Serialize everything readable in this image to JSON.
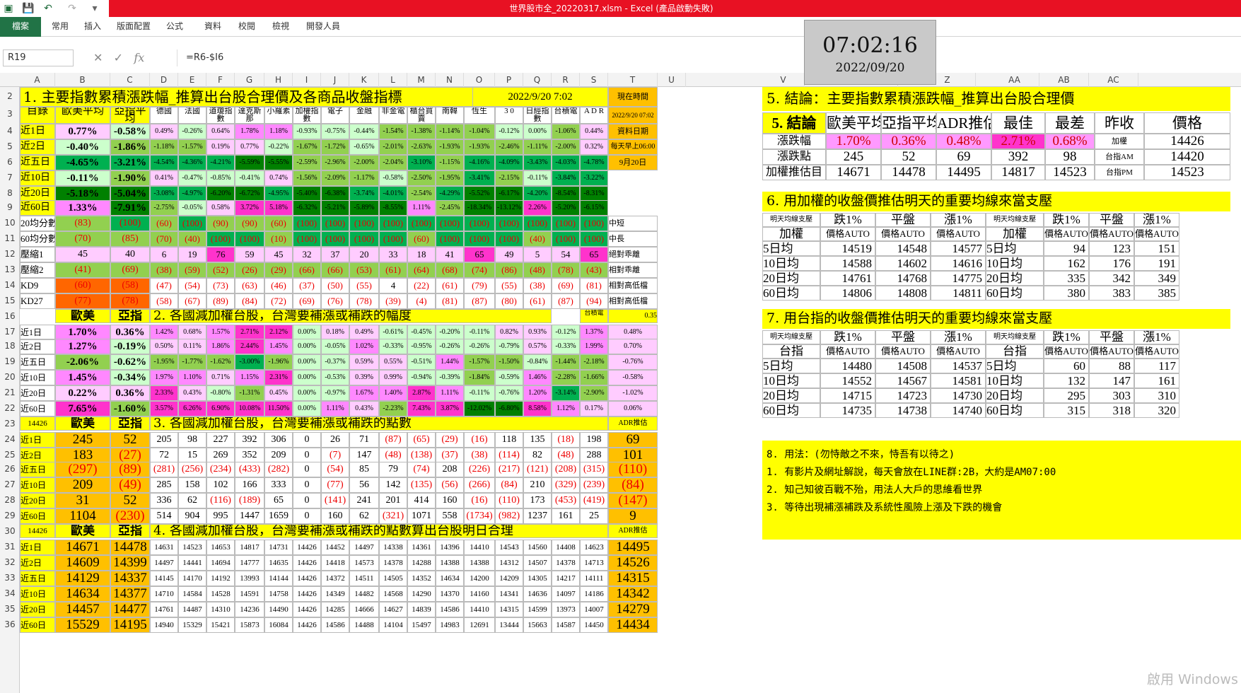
{
  "window": {
    "title": "世界股市全_20220317.xlsm - Excel (產品啟動失敗)"
  },
  "ribbon": {
    "tabs": [
      "檔案",
      "常用",
      "插入",
      "版面配置",
      "公式",
      "資料",
      "校閱",
      "檢視",
      "開發人員"
    ]
  },
  "formula_bar": {
    "name_box": "R19",
    "formula": "=R6-$I6"
  },
  "clock": {
    "time": "07:02:16",
    "date": "2022/09/20"
  },
  "columns": [
    "A",
    "B",
    "C",
    "D",
    "E",
    "F",
    "G",
    "H",
    "I",
    "J",
    "K",
    "L",
    "M",
    "N",
    "O",
    "P",
    "Q",
    "R",
    "S",
    "T",
    "U",
    "V",
    "Y",
    "Z",
    "AA",
    "AB",
    "AC"
  ],
  "rows": [
    "2",
    "3",
    "4",
    "5",
    "6",
    "7",
    "8",
    "9",
    "10",
    "11",
    "12",
    "13",
    "14",
    "15",
    "16",
    "17",
    "18",
    "19",
    "20",
    "21",
    "22",
    "23",
    "24",
    "25",
    "26",
    "27",
    "28",
    "29",
    "30",
    "31",
    "32",
    "33",
    "34",
    "35",
    "36"
  ],
  "section1": {
    "title": "1. 主要指數累積漲跌幅_推算出台股合理價及各商品收盤指標",
    "stamp": "2022/9/20  7:02",
    "now_label": "現在時間",
    "now_value": "2022/9/20 07:02",
    "date_label": "資料日期",
    "date_note": "每天早上06:00",
    "date_value": "9月20日"
  },
  "section2": {
    "title": "2. 各國減加權台股，台灣要補漲或補跌的幅度",
    "ratio": "0.35"
  },
  "section3": {
    "title": "3. 各國減加權台股，台灣要補漲或補跌的點數",
    "base": "14426",
    "adr": "ADR推估"
  },
  "section4": {
    "title": "4. 各國減加權台股，台灣要補漲或補跌的點數算出台股明日合理",
    "base": "14426",
    "adr": "ADR推估"
  },
  "header_row": [
    "目錄",
    "歐美平均",
    "亞指平均",
    "德國",
    "法國",
    "道瓊指數",
    "達克斯那",
    "小羅素",
    "加權指數",
    "電子",
    "金融",
    "非金電",
    "櫃台買賣",
    "南韓",
    "恆生",
    "3 0",
    "日經指數",
    "台積電",
    "A D R"
  ],
  "row_labels": [
    "近1日",
    "近2日",
    "近五日",
    "近10日",
    "近20日",
    "近60日"
  ],
  "s1_rows": [
    [
      "0.77%",
      "-0.58%",
      "0.49%",
      "-0.26%",
      "0.64%",
      "1.78%",
      "1.18%",
      "-0.93%",
      "-0.75%",
      "-0.44%",
      "-1.54%",
      "-1.38%",
      "-1.14%",
      "-1.04%",
      "-0.12%",
      "0.00%",
      "-1.06%",
      "0.44%"
    ],
    [
      "-0.40%",
      "-1.86%",
      "-1.18%",
      "-1.57%",
      "0.19%",
      "0.77%",
      "-0.22%",
      "-1.67%",
      "-1.72%",
      "-0.65%",
      "-2.01%",
      "-2.63%",
      "-1.93%",
      "-1.93%",
      "-2.46%",
      "-1.11%",
      "-2.00%",
      "0.32%"
    ],
    [
      "-4.65%",
      "-3.21%",
      "-4.54%",
      "-4.36%",
      "-4.21%",
      "-5.59%",
      "-5.55%",
      "-2.59%",
      "-2.96%",
      "-2.00%",
      "-2.04%",
      "-3.10%",
      "-1.15%",
      "-4.16%",
      "-4.09%",
      "-3.43%",
      "-4.03%",
      "-4.78%"
    ],
    [
      "-0.11%",
      "-1.90%",
      "0.41%",
      "-0.47%",
      "-0.85%",
      "-0.41%",
      "0.74%",
      "-1.56%",
      "-2.09%",
      "-1.17%",
      "-0.58%",
      "-2.50%",
      "-1.95%",
      "-3.41%",
      "-2.15%",
      "-0.11%",
      "-3.84%",
      "-3.22%"
    ],
    [
      "-5.18%",
      "-5.04%",
      "-3.08%",
      "-4.97%",
      "-6.20%",
      "-6.72%",
      "-4.95%",
      "-5.40%",
      "-6.38%",
      "-3.74%",
      "-4.01%",
      "-2.54%",
      "-4.29%",
      "-5.52%",
      "-6.17%",
      "-4.20%",
      "-8.54%",
      "-8.31%"
    ],
    [
      "1.33%",
      "-7.91%",
      "-2.75%",
      "-0.05%",
      "0.58%",
      "3.72%",
      "5.18%",
      "-6.32%",
      "-5.21%",
      "-5.89%",
      "-8.55%",
      "1.11%",
      "-2.45%",
      "-18.34%",
      "-13.12%",
      "2.26%",
      "-5.20%",
      "-6.15%"
    ]
  ],
  "s1_extra_labels": [
    "20均分數",
    "60均分數",
    "壓縮1",
    "壓縮2",
    "KD9",
    "KD27"
  ],
  "s1_extra": [
    [
      "(83)",
      "(100)",
      "(60)",
      "(100)",
      "(90)",
      "(90)",
      "(60)",
      "(100)",
      "(100)",
      "(100)",
      "(100)",
      "(100)",
      "(100)",
      "(100)",
      "(100)",
      "(100)",
      "(100)",
      "(100)"
    ],
    [
      "(70)",
      "(85)",
      "(70)",
      "(40)",
      "(100)",
      "(100)",
      "(10)",
      "(100)",
      "(100)",
      "(100)",
      "(100)",
      "(60)",
      "(100)",
      "(100)",
      "(100)",
      "(40)",
      "(100)",
      "(100)"
    ],
    [
      "45",
      "40",
      "6",
      "19",
      "76",
      "59",
      "45",
      "32",
      "37",
      "20",
      "33",
      "18",
      "41",
      "65",
      "49",
      "5",
      "54",
      "65"
    ],
    [
      "(41)",
      "(69)",
      "(38)",
      "(59)",
      "(52)",
      "(26)",
      "(29)",
      "(66)",
      "(66)",
      "(53)",
      "(61)",
      "(64)",
      "(68)",
      "(74)",
      "(86)",
      "(48)",
      "(78)",
      "(43)"
    ],
    [
      "(60)",
      "(58)",
      "(47)",
      "(54)",
      "(73)",
      "(63)",
      "(46)",
      "(37)",
      "(50)",
      "(55)",
      "4",
      "(22)",
      "(61)",
      "(79)",
      "(55)",
      "(38)",
      "(69)",
      "(81)"
    ],
    [
      "(77)",
      "(78)",
      "(58)",
      "(67)",
      "(89)",
      "(84)",
      "(72)",
      "(69)",
      "(76)",
      "(78)",
      "(39)",
      "(4)",
      "(81)",
      "(87)",
      "(80)",
      "(61)",
      "(87)",
      "(94)"
    ]
  ],
  "s1_extra_notes": [
    "中短",
    "中長",
    "絕對乖離",
    "相對乖離",
    "相對高低檔",
    "相對高低檔"
  ],
  "s2_head": [
    "歐美",
    "亞指",
    "",
    "",
    "",
    "",
    "",
    "",
    "",
    "",
    "",
    "",
    "",
    "",
    "",
    "",
    "台積電",
    "縮權"
  ],
  "s2_rows": [
    [
      "1.70%",
      "0.36%",
      "1.42%",
      "0.68%",
      "1.57%",
      "2.71%",
      "2.12%",
      "0.00%",
      "0.18%",
      "0.49%",
      "-0.61%",
      "-0.45%",
      "-0.20%",
      "-0.11%",
      "0.82%",
      "0.93%",
      "-0.12%",
      "1.37%",
      "0.48%"
    ],
    [
      "1.27%",
      "-0.19%",
      "0.50%",
      "0.11%",
      "1.86%",
      "2.44%",
      "1.45%",
      "0.00%",
      "-0.05%",
      "1.02%",
      "-0.33%",
      "-0.95%",
      "-0.26%",
      "-0.26%",
      "-0.79%",
      "0.57%",
      "-0.33%",
      "1.99%",
      "0.70%"
    ],
    [
      "-2.06%",
      "-0.62%",
      "-1.95%",
      "-1.77%",
      "-1.62%",
      "-3.00%",
      "-1.96%",
      "0.00%",
      "-0.37%",
      "0.59%",
      "0.55%",
      "-0.51%",
      "1.44%",
      "-1.57%",
      "-1.50%",
      "-0.84%",
      "-1.44%",
      "-2.18%",
      "-0.76%"
    ],
    [
      "1.45%",
      "-0.34%",
      "1.97%",
      "1.10%",
      "0.71%",
      "1.15%",
      "2.31%",
      "0.00%",
      "-0.53%",
      "0.39%",
      "0.99%",
      "-0.94%",
      "-0.39%",
      "-1.84%",
      "-0.59%",
      "1.46%",
      "-2.28%",
      "-1.66%",
      "-0.58%"
    ],
    [
      "0.22%",
      "0.36%",
      "2.33%",
      "0.43%",
      "-0.80%",
      "-1.31%",
      "0.45%",
      "0.00%",
      "-0.97%",
      "1.67%",
      "1.40%",
      "2.87%",
      "1.11%",
      "-0.11%",
      "-0.76%",
      "1.20%",
      "-3.14%",
      "-2.90%",
      "-1.02%"
    ],
    [
      "7.65%",
      "-1.60%",
      "3.57%",
      "6.26%",
      "6.90%",
      "10.08%",
      "11.50%",
      "0.00%",
      "1.11%",
      "0.43%",
      "-2.23%",
      "7.43%",
      "3.87%",
      "-12.02%",
      "-6.80%",
      "8.58%",
      "1.12%",
      "0.17%",
      "0.06%"
    ]
  ],
  "s3_rows": [
    [
      "245",
      "52",
      "205",
      "98",
      "227",
      "392",
      "306",
      "0",
      "26",
      "71",
      "(87)",
      "(65)",
      "(29)",
      "(16)",
      "118",
      "135",
      "(18)",
      "198",
      "69"
    ],
    [
      "183",
      "(27)",
      "72",
      "15",
      "269",
      "352",
      "209",
      "0",
      "(7)",
      "147",
      "(48)",
      "(138)",
      "(37)",
      "(38)",
      "(114)",
      "82",
      "(48)",
      "288",
      "101"
    ],
    [
      "(297)",
      "(89)",
      "(281)",
      "(256)",
      "(234)",
      "(433)",
      "(282)",
      "0",
      "(54)",
      "85",
      "79",
      "(74)",
      "208",
      "(226)",
      "(217)",
      "(121)",
      "(208)",
      "(315)",
      "(110)"
    ],
    [
      "209",
      "(49)",
      "285",
      "158",
      "102",
      "166",
      "333",
      "0",
      "(77)",
      "56",
      "142",
      "(135)",
      "(56)",
      "(266)",
      "(84)",
      "210",
      "(329)",
      "(239)",
      "(84)"
    ],
    [
      "31",
      "52",
      "336",
      "62",
      "(116)",
      "(189)",
      "65",
      "0",
      "(141)",
      "241",
      "201",
      "414",
      "160",
      "(16)",
      "(110)",
      "173",
      "(453)",
      "(419)",
      "(147)"
    ],
    [
      "1104",
      "(230)",
      "514",
      "904",
      "995",
      "1447",
      "1659",
      "0",
      "160",
      "62",
      "(321)",
      "1071",
      "558",
      "(1734)",
      "(982)",
      "1237",
      "161",
      "25",
      "9"
    ]
  ],
  "s4_rows": [
    [
      "14671",
      "14478",
      "14631",
      "14523",
      "14653",
      "14817",
      "14731",
      "14426",
      "14452",
      "14497",
      "14338",
      "14361",
      "14396",
      "14410",
      "14543",
      "14560",
      "14408",
      "14623",
      "14495"
    ],
    [
      "14609",
      "14399",
      "14497",
      "14441",
      "14694",
      "14777",
      "14635",
      "14426",
      "14418",
      "14573",
      "14378",
      "14288",
      "14388",
      "14388",
      "14312",
      "14507",
      "14378",
      "14713",
      "14526"
    ],
    [
      "14129",
      "14337",
      "14145",
      "14170",
      "14192",
      "13993",
      "14144",
      "14426",
      "14372",
      "14511",
      "14505",
      "14352",
      "14634",
      "14200",
      "14209",
      "14305",
      "14217",
      "14111",
      "14315"
    ],
    [
      "14634",
      "14377",
      "14710",
      "14584",
      "14528",
      "14591",
      "14758",
      "14426",
      "14349",
      "14482",
      "14568",
      "14290",
      "14370",
      "14160",
      "14341",
      "14636",
      "14097",
      "14186",
      "14342"
    ],
    [
      "14457",
      "14477",
      "14761",
      "14487",
      "14310",
      "14236",
      "14490",
      "14426",
      "14285",
      "14666",
      "14627",
      "14839",
      "14586",
      "14410",
      "14315",
      "14599",
      "13973",
      "14007",
      "14279"
    ],
    [
      "15529",
      "14195",
      "14940",
      "15329",
      "15421",
      "15873",
      "16084",
      "14426",
      "14586",
      "14488",
      "14104",
      "15497",
      "14983",
      "12691",
      "13444",
      "15663",
      "14587",
      "14450",
      "14434"
    ]
  ],
  "section5": {
    "title": "5. 結論：主要指數累積漲跌幅_推算出台股合理價",
    "head": [
      "5. 結論",
      "歐美平均",
      "亞指平均",
      "ADR推估",
      "最佳",
      "最差",
      "昨收",
      "價格"
    ],
    "rows": [
      [
        "漲跌幅",
        "1.70%",
        "0.36%",
        "0.48%",
        "2.71%",
        "0.68%",
        "加權",
        "14426"
      ],
      [
        "漲跌點",
        "245",
        "52",
        "69",
        "392",
        "98",
        "台指AM",
        "14420"
      ],
      [
        "加權推估目",
        "14671",
        "14478",
        "14495",
        "14817",
        "14523",
        "台指PM",
        "14523"
      ]
    ]
  },
  "section6": {
    "title": "6. 用加權的收盤價推估明天的重要均線來當支壓",
    "head": [
      "明天均線支壓",
      "跌1%",
      "平盤",
      "漲1%",
      "明天均線支壓",
      "跌1%",
      "平盤",
      "漲1%"
    ],
    "sub": [
      "加權",
      "價格AUTO",
      "價格AUTO",
      "價格AUTO",
      "加權",
      "價格AUTO",
      "價格AUTO",
      "價格AUTO"
    ],
    "rows": [
      [
        "5日均",
        "14519",
        "14548",
        "14577",
        "5日均",
        "94",
        "123",
        "151"
      ],
      [
        "10日均",
        "14588",
        "14602",
        "14616",
        "10日均",
        "162",
        "176",
        "191"
      ],
      [
        "20日均",
        "14761",
        "14768",
        "14775",
        "20日均",
        "335",
        "342",
        "349"
      ],
      [
        "60日均",
        "14806",
        "14808",
        "14811",
        "60日均",
        "380",
        "383",
        "385"
      ]
    ]
  },
  "section7": {
    "title": "7. 用台指的收盤價推估明天的重要均線來當支壓",
    "head": [
      "明天均線支壓",
      "跌1%",
      "平盤",
      "漲1%",
      "明天均線支壓",
      "跌1%",
      "平盤",
      "漲1%"
    ],
    "sub": [
      "台指",
      "價格AUTO",
      "價格AUTO",
      "價格AUTO",
      "台指",
      "價格AUTO",
      "價格AUTO",
      "價格AUTO"
    ],
    "rows": [
      [
        "5日均",
        "14480",
        "14508",
        "14537",
        "5日均",
        "60",
        "88",
        "117"
      ],
      [
        "10日均",
        "14552",
        "14567",
        "14581",
        "10日均",
        "132",
        "147",
        "161"
      ],
      [
        "20日均",
        "14715",
        "14723",
        "14730",
        "20日均",
        "295",
        "303",
        "310"
      ],
      [
        "60日均",
        "14735",
        "14738",
        "14740",
        "60日均",
        "315",
        "318",
        "320"
      ]
    ]
  },
  "section8": {
    "lines": [
      "8. 用法：(勿恃敵之不來，恃吾有以待之)",
      "1. 有影片及網址解說，每天會放在LINE群:2B，大約是AM07:00",
      "2. 知己知彼百戰不殆，用法人大戶的思維看世界",
      "3. 等待出現補漲補跌及系統性風險上漲及下跌的機會"
    ]
  },
  "watermark": "啟用 Windows",
  "colors": {
    "excel_green": "#217346",
    "title_red": "#e81123",
    "yellow": "#ffff00",
    "orange": "#ffc000",
    "dark_green": "#00b050",
    "green": "#92d050",
    "magenta": "#ff66ff",
    "red": "#ff0000"
  }
}
